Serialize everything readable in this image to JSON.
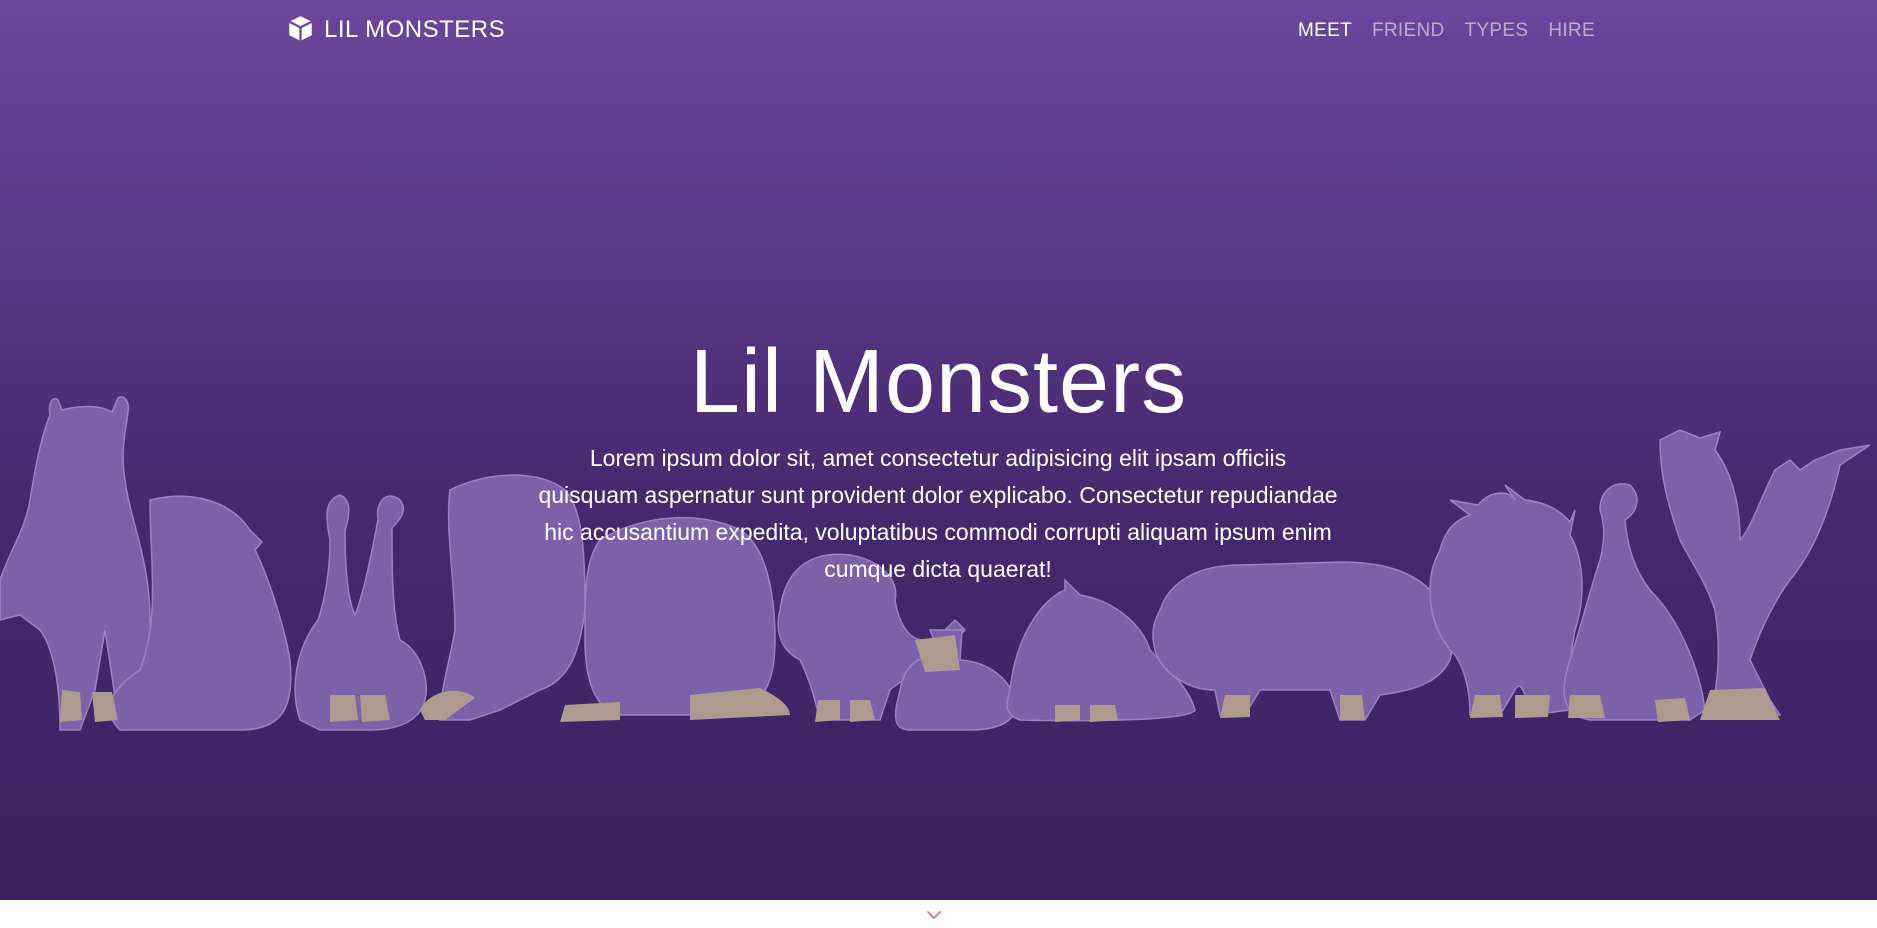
{
  "header": {
    "brand_icon": "cube-icon",
    "brand_text": "LIL MONSTERS",
    "nav": [
      {
        "label": "MEET",
        "active": true
      },
      {
        "label": "FRIEND",
        "active": false
      },
      {
        "label": "TYPES",
        "active": false
      },
      {
        "label": "HIRE",
        "active": false
      }
    ]
  },
  "hero": {
    "title": "Lil Monsters",
    "lead": "Lorem ipsum dolor sit, amet consectetur adipisicing elit ipsam officiis quisquam aspernatur sunt provident dolor explicabo. Consectetur repudiandae hic accusantium expedita, voluptatibus commodi corrupti aliquam ipsum enim cumque dicta quaerat!"
  },
  "scroll": {
    "icon": "chevron-down-icon"
  },
  "colors": {
    "hero_top": "#6b469b",
    "hero_bottom": "#3a2262",
    "monster_fill": "#7d61a8",
    "monster_feet": "#b09a90",
    "chevron": "#d98a8f"
  }
}
